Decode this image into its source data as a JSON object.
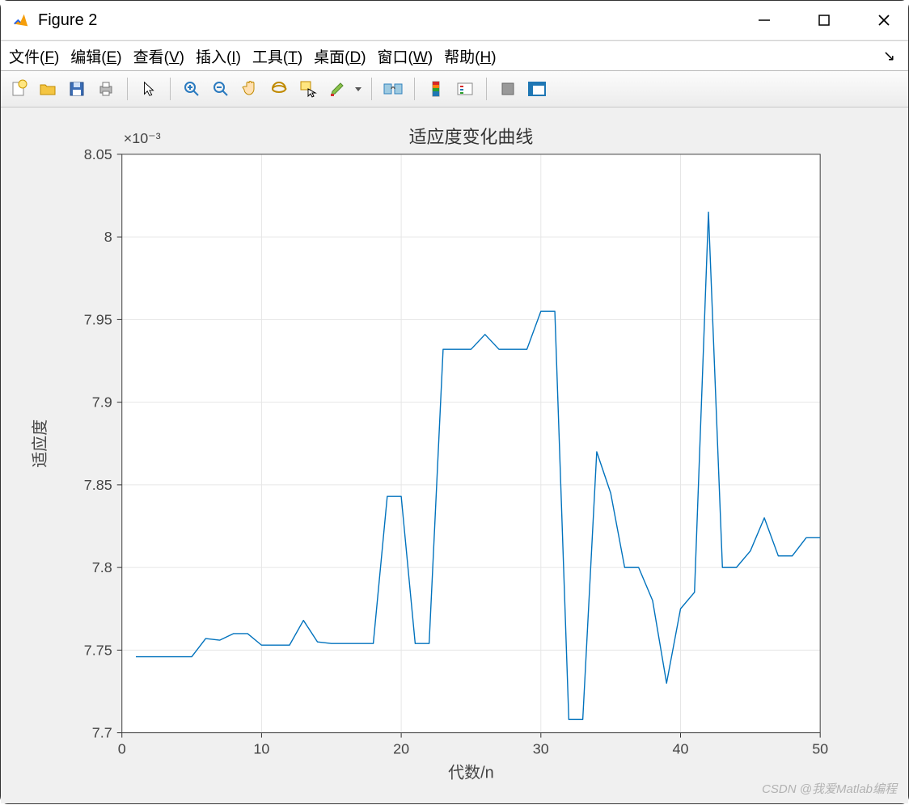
{
  "window": {
    "title": "Figure 2"
  },
  "menu": {
    "file": {
      "label": "文件(",
      "key": "F",
      "suffix": ")"
    },
    "edit": {
      "label": "编辑(",
      "key": "E",
      "suffix": ")"
    },
    "view": {
      "label": "查看(",
      "key": "V",
      "suffix": ")"
    },
    "insert": {
      "label": "插入(",
      "key": "I",
      "suffix": ")"
    },
    "tools": {
      "label": "工具(",
      "key": "T",
      "suffix": ")"
    },
    "desktop": {
      "label": "桌面(",
      "key": "D",
      "suffix": ")"
    },
    "window_m": {
      "label": "窗口(",
      "key": "W",
      "suffix": ")"
    },
    "help": {
      "label": "帮助(",
      "key": "H",
      "suffix": ")"
    }
  },
  "watermark": "CSDN @我爱Matlab编程",
  "chart_data": {
    "type": "line",
    "title": "适应度变化曲线",
    "xlabel": "代数/n",
    "ylabel": "适应度",
    "y_exponent": "×10⁻³",
    "xlim": [
      0,
      50
    ],
    "ylim": [
      7.7,
      8.05
    ],
    "xticks": [
      0,
      10,
      20,
      30,
      40,
      50
    ],
    "yticks": [
      7.7,
      7.75,
      7.8,
      7.85,
      7.9,
      7.95,
      8,
      8.05
    ],
    "x": [
      1,
      2,
      3,
      4,
      5,
      6,
      7,
      8,
      9,
      10,
      11,
      12,
      13,
      14,
      15,
      16,
      17,
      18,
      19,
      20,
      21,
      22,
      23,
      24,
      25,
      26,
      27,
      28,
      29,
      30,
      31,
      32,
      33,
      34,
      35,
      36,
      37,
      38,
      39,
      40,
      41,
      42,
      43,
      44,
      45,
      46,
      47,
      48,
      49,
      50
    ],
    "y": [
      7.746,
      7.746,
      7.746,
      7.746,
      7.746,
      7.757,
      7.756,
      7.76,
      7.76,
      7.753,
      7.753,
      7.753,
      7.768,
      7.755,
      7.754,
      7.754,
      7.754,
      7.754,
      7.843,
      7.843,
      7.754,
      7.754,
      7.932,
      7.932,
      7.932,
      7.941,
      7.932,
      7.932,
      7.932,
      7.955,
      7.955,
      7.708,
      7.708,
      7.87,
      7.845,
      7.8,
      7.8,
      7.78,
      7.73,
      7.775,
      7.785,
      8.015,
      7.8,
      7.8,
      7.81,
      7.83,
      7.807,
      7.807,
      7.818,
      7.818
    ]
  }
}
